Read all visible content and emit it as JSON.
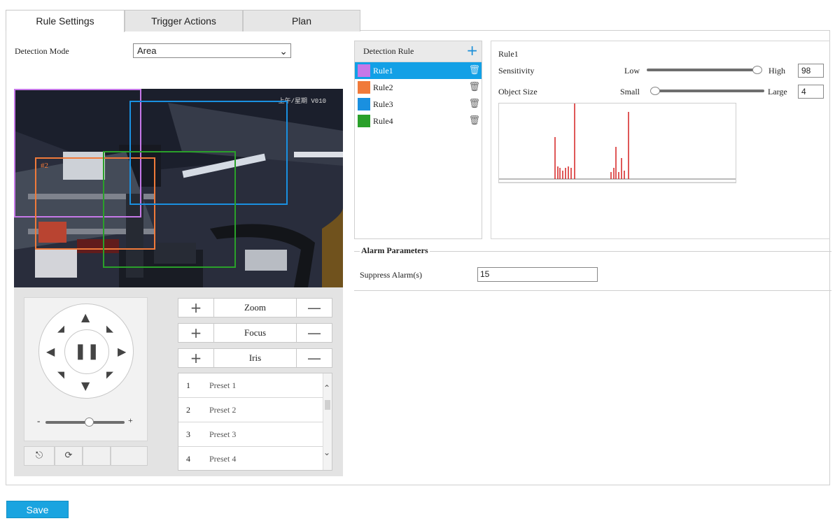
{
  "tabs": [
    {
      "label": "Rule Settings",
      "active": true
    },
    {
      "label": "Trigger Actions",
      "active": false
    },
    {
      "label": "Plan",
      "active": false
    }
  ],
  "detection_mode": {
    "label": "Detection Mode",
    "value": "Area"
  },
  "video": {
    "osd_text": "上午/星期 V010",
    "roi_label": "#2"
  },
  "ptz": {
    "zoom_label": "Zoom",
    "focus_label": "Focus",
    "iris_label": "Iris",
    "plus_symbol": "+",
    "minus_symbol": "—",
    "speed_minus": "-",
    "speed_plus": "+",
    "speed_level": 0.55,
    "presets": [
      {
        "number": "1",
        "name": "Preset 1"
      },
      {
        "number": "2",
        "name": "Preset 2"
      },
      {
        "number": "3",
        "name": "Preset 3"
      },
      {
        "number": "4",
        "name": "Preset 4"
      }
    ]
  },
  "detection_rule": {
    "header": "Detection Rule",
    "add_symbol": "+",
    "rules": [
      {
        "name": "Rule1",
        "color": "#c678e8",
        "selected": true
      },
      {
        "name": "Rule2",
        "color": "#f07a3a",
        "selected": false
      },
      {
        "name": "Rule3",
        "color": "#1a90e0",
        "selected": false
      },
      {
        "name": "Rule4",
        "color": "#2aa02a",
        "selected": false
      }
    ]
  },
  "rule_detail": {
    "title": "Rule1",
    "sensitivity_label": "Sensitivity",
    "sensitivity_low": "Low",
    "sensitivity_high": "High",
    "sensitivity_value": "98",
    "object_size_label": "Object Size",
    "object_size_small": "Small",
    "object_size_large": "Large",
    "object_size_value": "4"
  },
  "alarm": {
    "legend": "Alarm Parameters",
    "suppress_label": "Suppress Alarm(s)",
    "suppress_value": "15"
  },
  "save_label": "Save",
  "colors": {
    "accent": "#1aa4e0",
    "selected_row": "#12a0e6",
    "histogram": "#d42020"
  }
}
